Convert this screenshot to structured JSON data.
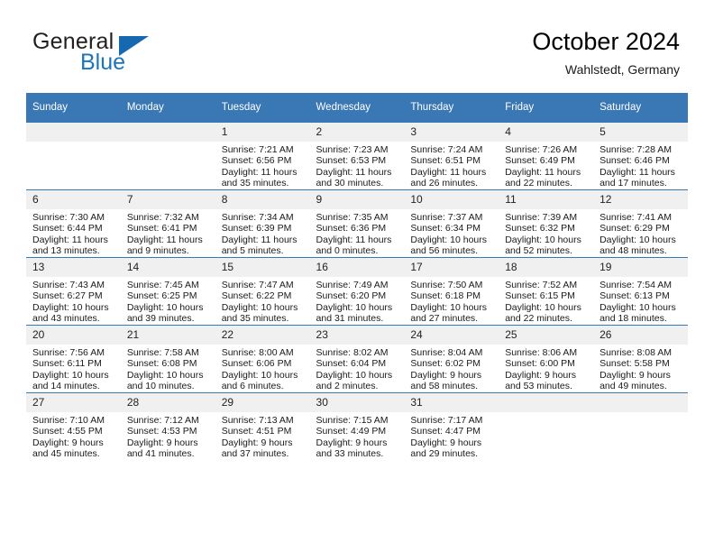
{
  "brand": {
    "name_part1": "General",
    "name_part2": "Blue",
    "accent_color": "#1b75bb",
    "logo_icon": "triangle-icon"
  },
  "header": {
    "title": "October 2024",
    "subtitle": "Wahlstedt, Germany"
  },
  "calendar": {
    "header_bg": "#3a77b5",
    "daynum_bg": "#f0f0f0",
    "weekday_headers": [
      "Sunday",
      "Monday",
      "Tuesday",
      "Wednesday",
      "Thursday",
      "Friday",
      "Saturday"
    ],
    "weeks": [
      [
        {
          "day": "",
          "sunrise": "",
          "sunset": "",
          "daylight": ""
        },
        {
          "day": "",
          "sunrise": "",
          "sunset": "",
          "daylight": ""
        },
        {
          "day": "1",
          "sunrise": "Sunrise: 7:21 AM",
          "sunset": "Sunset: 6:56 PM",
          "daylight": "Daylight: 11 hours and 35 minutes."
        },
        {
          "day": "2",
          "sunrise": "Sunrise: 7:23 AM",
          "sunset": "Sunset: 6:53 PM",
          "daylight": "Daylight: 11 hours and 30 minutes."
        },
        {
          "day": "3",
          "sunrise": "Sunrise: 7:24 AM",
          "sunset": "Sunset: 6:51 PM",
          "daylight": "Daylight: 11 hours and 26 minutes."
        },
        {
          "day": "4",
          "sunrise": "Sunrise: 7:26 AM",
          "sunset": "Sunset: 6:49 PM",
          "daylight": "Daylight: 11 hours and 22 minutes."
        },
        {
          "day": "5",
          "sunrise": "Sunrise: 7:28 AM",
          "sunset": "Sunset: 6:46 PM",
          "daylight": "Daylight: 11 hours and 17 minutes."
        }
      ],
      [
        {
          "day": "6",
          "sunrise": "Sunrise: 7:30 AM",
          "sunset": "Sunset: 6:44 PM",
          "daylight": "Daylight: 11 hours and 13 minutes."
        },
        {
          "day": "7",
          "sunrise": "Sunrise: 7:32 AM",
          "sunset": "Sunset: 6:41 PM",
          "daylight": "Daylight: 11 hours and 9 minutes."
        },
        {
          "day": "8",
          "sunrise": "Sunrise: 7:34 AM",
          "sunset": "Sunset: 6:39 PM",
          "daylight": "Daylight: 11 hours and 5 minutes."
        },
        {
          "day": "9",
          "sunrise": "Sunrise: 7:35 AM",
          "sunset": "Sunset: 6:36 PM",
          "daylight": "Daylight: 11 hours and 0 minutes."
        },
        {
          "day": "10",
          "sunrise": "Sunrise: 7:37 AM",
          "sunset": "Sunset: 6:34 PM",
          "daylight": "Daylight: 10 hours and 56 minutes."
        },
        {
          "day": "11",
          "sunrise": "Sunrise: 7:39 AM",
          "sunset": "Sunset: 6:32 PM",
          "daylight": "Daylight: 10 hours and 52 minutes."
        },
        {
          "day": "12",
          "sunrise": "Sunrise: 7:41 AM",
          "sunset": "Sunset: 6:29 PM",
          "daylight": "Daylight: 10 hours and 48 minutes."
        }
      ],
      [
        {
          "day": "13",
          "sunrise": "Sunrise: 7:43 AM",
          "sunset": "Sunset: 6:27 PM",
          "daylight": "Daylight: 10 hours and 43 minutes."
        },
        {
          "day": "14",
          "sunrise": "Sunrise: 7:45 AM",
          "sunset": "Sunset: 6:25 PM",
          "daylight": "Daylight: 10 hours and 39 minutes."
        },
        {
          "day": "15",
          "sunrise": "Sunrise: 7:47 AM",
          "sunset": "Sunset: 6:22 PM",
          "daylight": "Daylight: 10 hours and 35 minutes."
        },
        {
          "day": "16",
          "sunrise": "Sunrise: 7:49 AM",
          "sunset": "Sunset: 6:20 PM",
          "daylight": "Daylight: 10 hours and 31 minutes."
        },
        {
          "day": "17",
          "sunrise": "Sunrise: 7:50 AM",
          "sunset": "Sunset: 6:18 PM",
          "daylight": "Daylight: 10 hours and 27 minutes."
        },
        {
          "day": "18",
          "sunrise": "Sunrise: 7:52 AM",
          "sunset": "Sunset: 6:15 PM",
          "daylight": "Daylight: 10 hours and 22 minutes."
        },
        {
          "day": "19",
          "sunrise": "Sunrise: 7:54 AM",
          "sunset": "Sunset: 6:13 PM",
          "daylight": "Daylight: 10 hours and 18 minutes."
        }
      ],
      [
        {
          "day": "20",
          "sunrise": "Sunrise: 7:56 AM",
          "sunset": "Sunset: 6:11 PM",
          "daylight": "Daylight: 10 hours and 14 minutes."
        },
        {
          "day": "21",
          "sunrise": "Sunrise: 7:58 AM",
          "sunset": "Sunset: 6:08 PM",
          "daylight": "Daylight: 10 hours and 10 minutes."
        },
        {
          "day": "22",
          "sunrise": "Sunrise: 8:00 AM",
          "sunset": "Sunset: 6:06 PM",
          "daylight": "Daylight: 10 hours and 6 minutes."
        },
        {
          "day": "23",
          "sunrise": "Sunrise: 8:02 AM",
          "sunset": "Sunset: 6:04 PM",
          "daylight": "Daylight: 10 hours and 2 minutes."
        },
        {
          "day": "24",
          "sunrise": "Sunrise: 8:04 AM",
          "sunset": "Sunset: 6:02 PM",
          "daylight": "Daylight: 9 hours and 58 minutes."
        },
        {
          "day": "25",
          "sunrise": "Sunrise: 8:06 AM",
          "sunset": "Sunset: 6:00 PM",
          "daylight": "Daylight: 9 hours and 53 minutes."
        },
        {
          "day": "26",
          "sunrise": "Sunrise: 8:08 AM",
          "sunset": "Sunset: 5:58 PM",
          "daylight": "Daylight: 9 hours and 49 minutes."
        }
      ],
      [
        {
          "day": "27",
          "sunrise": "Sunrise: 7:10 AM",
          "sunset": "Sunset: 4:55 PM",
          "daylight": "Daylight: 9 hours and 45 minutes."
        },
        {
          "day": "28",
          "sunrise": "Sunrise: 7:12 AM",
          "sunset": "Sunset: 4:53 PM",
          "daylight": "Daylight: 9 hours and 41 minutes."
        },
        {
          "day": "29",
          "sunrise": "Sunrise: 7:13 AM",
          "sunset": "Sunset: 4:51 PM",
          "daylight": "Daylight: 9 hours and 37 minutes."
        },
        {
          "day": "30",
          "sunrise": "Sunrise: 7:15 AM",
          "sunset": "Sunset: 4:49 PM",
          "daylight": "Daylight: 9 hours and 33 minutes."
        },
        {
          "day": "31",
          "sunrise": "Sunrise: 7:17 AM",
          "sunset": "Sunset: 4:47 PM",
          "daylight": "Daylight: 9 hours and 29 minutes."
        },
        {
          "day": "",
          "sunrise": "",
          "sunset": "",
          "daylight": ""
        },
        {
          "day": "",
          "sunrise": "",
          "sunset": "",
          "daylight": ""
        }
      ]
    ]
  }
}
